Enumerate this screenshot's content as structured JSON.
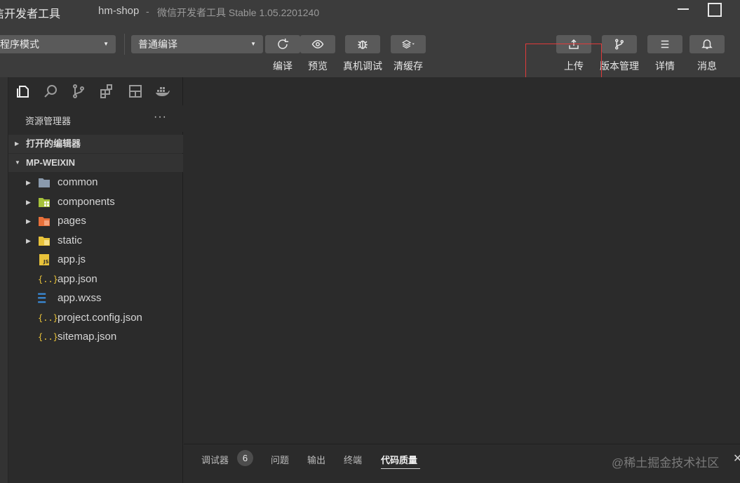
{
  "titlebar": {
    "app_title": "信开发者工具",
    "project_name": "hm-shop",
    "separator": "-",
    "ide_version": "微信开发者工具 Stable 1.05.2201240"
  },
  "toolbar": {
    "mode_select": "程序模式",
    "compile_select": "普通编译",
    "buttons": [
      {
        "label": "编译",
        "icon": "refresh-icon"
      },
      {
        "label": "预览",
        "icon": "eye-icon"
      },
      {
        "label": "真机调试",
        "icon": "bug-icon"
      },
      {
        "label": "清缓存",
        "icon": "layers-icon"
      },
      {
        "label": "上传",
        "icon": "upload-icon"
      },
      {
        "label": "版本管理",
        "icon": "branch-icon"
      },
      {
        "label": "详情",
        "icon": "menu-icon"
      },
      {
        "label": "消息",
        "icon": "bell-icon"
      }
    ],
    "highlight_color": "#e03a3a"
  },
  "sidebar": {
    "explorer_title": "资源管理器",
    "more": "···",
    "open_editors": "打开的编辑器",
    "project_root": "MP-WEIXIN",
    "tree": [
      {
        "label": "common",
        "type": "folder"
      },
      {
        "label": "components",
        "type": "folder"
      },
      {
        "label": "pages",
        "type": "folder"
      },
      {
        "label": "static",
        "type": "folder"
      },
      {
        "label": "app.js",
        "type": "js"
      },
      {
        "label": "app.json",
        "type": "json"
      },
      {
        "label": "app.wxss",
        "type": "css"
      },
      {
        "label": "project.config.json",
        "type": "json"
      },
      {
        "label": "sitemap.json",
        "type": "json"
      }
    ]
  },
  "panel": {
    "tabs": [
      {
        "label": "调试器"
      },
      {
        "label": "问题"
      },
      {
        "label": "输出"
      },
      {
        "label": "终端"
      },
      {
        "label": "代码质量"
      }
    ],
    "debugger_badge": "6",
    "watermark": "@稀土掘金技术社区",
    "close": "✕"
  }
}
